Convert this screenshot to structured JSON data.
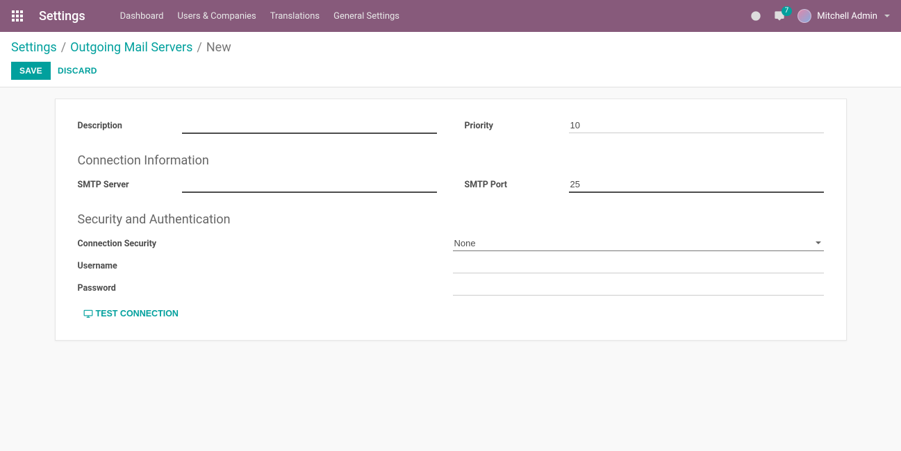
{
  "topbar": {
    "brand": "Settings",
    "nav": [
      "Dashboard",
      "Users & Companies",
      "Translations",
      "General Settings"
    ],
    "chat_count": "7",
    "user_name": "Mitchell Admin"
  },
  "breadcrumb": {
    "root": "Settings",
    "parent": "Outgoing Mail Servers",
    "current": "New"
  },
  "buttons": {
    "save": "SAVE",
    "discard": "DISCARD",
    "test_connection": "TEST CONNECTION"
  },
  "form": {
    "description_label": "Description",
    "description_value": "",
    "priority_label": "Priority",
    "priority_value": "10",
    "section_connection": "Connection Information",
    "smtp_server_label": "SMTP Server",
    "smtp_server_value": "",
    "smtp_port_label": "SMTP Port",
    "smtp_port_value": "25",
    "section_security": "Security and Authentication",
    "conn_security_label": "Connection Security",
    "conn_security_value": "None",
    "username_label": "Username",
    "username_value": "",
    "password_label": "Password",
    "password_value": ""
  }
}
